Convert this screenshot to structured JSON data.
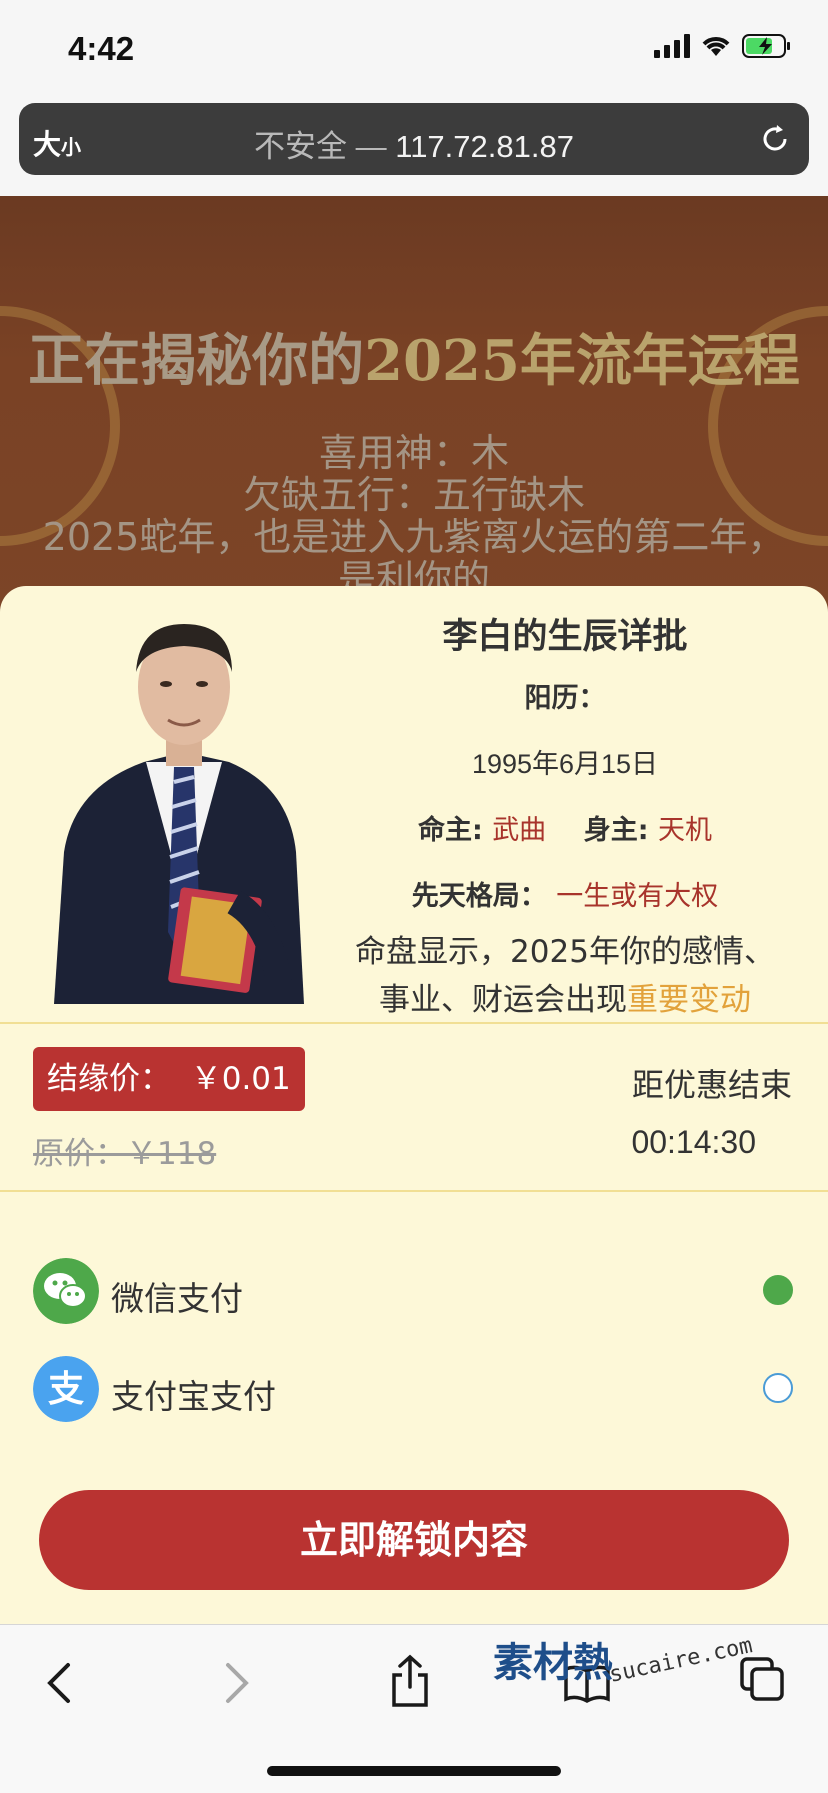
{
  "status": {
    "time": "4:42"
  },
  "browser": {
    "text_size_big": "大",
    "text_size_small": "小",
    "insecure": "不安全",
    "separator": " — ",
    "host": "117.72.81.87"
  },
  "hero": {
    "title_part1": "正在揭秘你的",
    "title_part2": "2025年流年运程",
    "line1": "喜用神：木",
    "line2": "欠缺五行：五行缺木",
    "line3": "2025蛇年，也是进入九紫离火运的第二年，",
    "line4": "是利你的"
  },
  "detail": {
    "title": "李白的生辰详批",
    "yangli_label": "阳历：",
    "date": "1995年6月15日",
    "mingzhu_label": "命主:",
    "mingzhu_value": "武曲",
    "shenzhu_label": "身主:",
    "shenzhu_value": "天机",
    "geju_label": "先天格局：",
    "geju_value": "一生或有大权",
    "summary_line1": "命盘显示，2025年你的感情、",
    "summary_line2": "事业、财运会出现",
    "summary_highlight": "重要变动"
  },
  "pricing": {
    "deal_label": "结缘价：",
    "deal_price": "￥0.01",
    "original": "原价：￥118",
    "countdown_label": "距优惠结束",
    "countdown": "00:14:30"
  },
  "payment": {
    "options": [
      {
        "label": "微信支付",
        "selected": true,
        "color": "#4ea84a"
      },
      {
        "label": "支付宝支付",
        "selected": false,
        "color": "#4a9bd6"
      }
    ]
  },
  "cta": {
    "label": "立即解锁内容"
  },
  "watermark": {
    "logo": "素材熱",
    "site": "sucaire.com"
  },
  "colors": {
    "primary": "#b93331",
    "highlight": "#e2a23b",
    "sheet": "#fdf8d8"
  }
}
